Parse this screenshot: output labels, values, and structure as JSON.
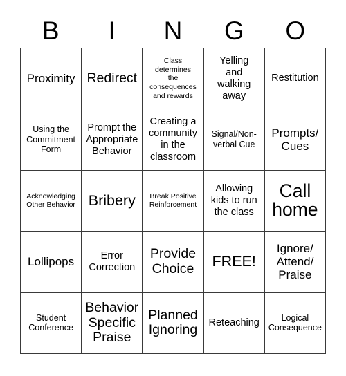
{
  "card": {
    "title": "BINGO",
    "header_letters": [
      "B",
      "I",
      "N",
      "G",
      "O"
    ],
    "free_space_label": "FREE!",
    "grid_line_color": "#3a3a3a",
    "background_color": "#ffffff",
    "text_color": "#000000",
    "rows": 5,
    "columns": 5,
    "cells": [
      {
        "text": "Proximity",
        "size": "fs-l"
      },
      {
        "text": "Redirect",
        "size": "fs-xl"
      },
      {
        "text": "Class\ndetermines\nthe\nconsequences\nand rewards",
        "size": "fs-xs"
      },
      {
        "text": "Yelling\nand\nwalking\naway",
        "size": "fs-m"
      },
      {
        "text": "Restitution",
        "size": "fs-m"
      },
      {
        "text": "Using the\nCommitment\nForm",
        "size": "fs-s"
      },
      {
        "text": "Prompt the\nAppropriate\nBehavior",
        "size": "fs-m"
      },
      {
        "text": "Creating a\ncommunity\nin the\nclassroom",
        "size": "fs-m"
      },
      {
        "text": "Signal/Non-\nverbal Cue",
        "size": "fs-s"
      },
      {
        "text": "Prompts/\nCues",
        "size": "fs-l"
      },
      {
        "text": "Acknowledging\nOther Behavior",
        "size": "fs-xs"
      },
      {
        "text": "Bribery",
        "size": "fs-xxl"
      },
      {
        "text": "Break Positive\nReinforcement",
        "size": "fs-xs"
      },
      {
        "text": "Allowing\nkids to run\nthe class",
        "size": "fs-m"
      },
      {
        "text": "Call\nhome",
        "size": "fs-huge"
      },
      {
        "text": "Lollipops",
        "size": "fs-l"
      },
      {
        "text": "Error\nCorrection",
        "size": "fs-m"
      },
      {
        "text": "Provide\nChoice",
        "size": "fs-xl"
      },
      {
        "text": "FREE!",
        "size": "fs-xxl"
      },
      {
        "text": "Ignore/\nAttend/\nPraise",
        "size": "fs-l"
      },
      {
        "text": "Student\nConference",
        "size": "fs-s"
      },
      {
        "text": "Behavior\nSpecific\nPraise",
        "size": "fs-xl"
      },
      {
        "text": "Planned\nIgnoring",
        "size": "fs-xl"
      },
      {
        "text": "Reteaching",
        "size": "fs-m"
      },
      {
        "text": "Logical\nConsequence",
        "size": "fs-s"
      }
    ]
  }
}
